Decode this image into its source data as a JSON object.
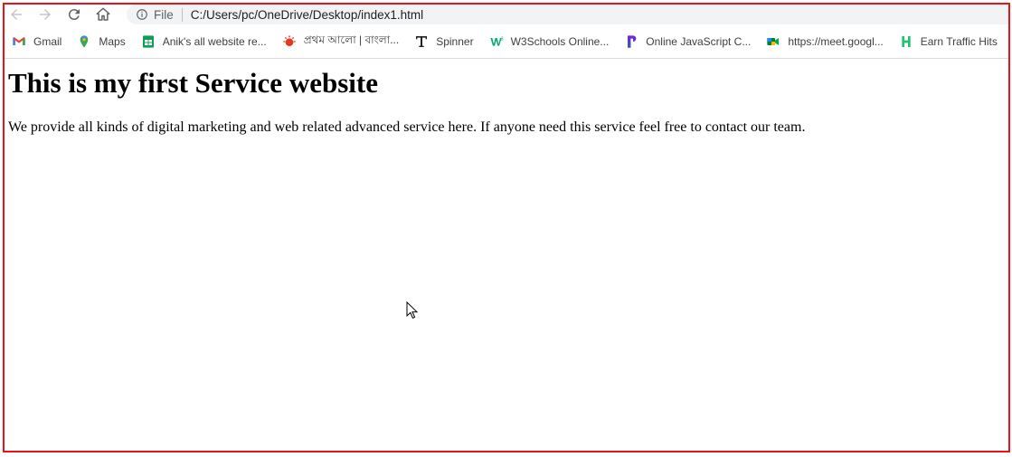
{
  "browser": {
    "address_scheme": "File",
    "address_url": "C:/Users/pc/OneDrive/Desktop/index1.html"
  },
  "bookmarks": [
    {
      "label": "Gmail",
      "icon": "gmail-icon"
    },
    {
      "label": "Maps",
      "icon": "maps-icon"
    },
    {
      "label": "Anik's all website re...",
      "icon": "sheets-icon"
    },
    {
      "label": "প্রথম আলো | বাংলা...",
      "icon": "prothomalo-icon"
    },
    {
      "label": "Spinner",
      "icon": "spinner-t-icon"
    },
    {
      "label": "W3Schools Online...",
      "icon": "w3schools-icon"
    },
    {
      "label": "Online JavaScript C...",
      "icon": "playcode-icon"
    },
    {
      "label": "https://meet.googl...",
      "icon": "meet-icon"
    },
    {
      "label": "Earn Traffic Hits",
      "icon": "earn-traffic-icon"
    }
  ],
  "page": {
    "heading": "This is my first Service website",
    "paragraph": "We provide all kinds of digital marketing and web related advanced service here. If anyone need this service feel free to contact our team."
  },
  "colors": {
    "frame": "#e8141a",
    "omnibox": "#f1f3f4"
  }
}
